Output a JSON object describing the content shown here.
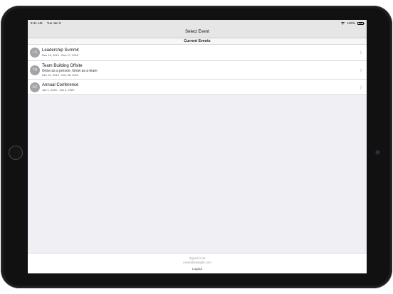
{
  "status_bar": {
    "time": "9:41 AM",
    "date": "Tue Jan 9",
    "battery": "100%"
  },
  "nav": {
    "title": "Select Event"
  },
  "section": {
    "title": "Current Events"
  },
  "events": [
    {
      "initials": "LS",
      "title": "Leadership Summit",
      "subtitle": "",
      "dates": "Dec 15, 2019 - Dec 17, 2019"
    },
    {
      "initials": "TB",
      "title": "Team Building Offsite",
      "subtitle": "Grow as a person, Grow as a team",
      "dates": "Dec 22, 2019 - Dec 26, 2019"
    },
    {
      "initials": "AC",
      "title": "Annual Conference",
      "subtitle": "",
      "dates": "Jan 1, 2020 - Jan 3, 2020"
    }
  ],
  "footer": {
    "signed_in_label": "Signed in as",
    "email": "event@example.com",
    "logout_label": "Logout"
  },
  "icons": {
    "wifi": "wifi-icon",
    "battery": "battery-icon",
    "chevron": "chevron-right-icon"
  },
  "colors": {
    "avatar": "#a3a3a8",
    "nav_background": "#e6e6e6",
    "screen_background": "#efeff4"
  }
}
